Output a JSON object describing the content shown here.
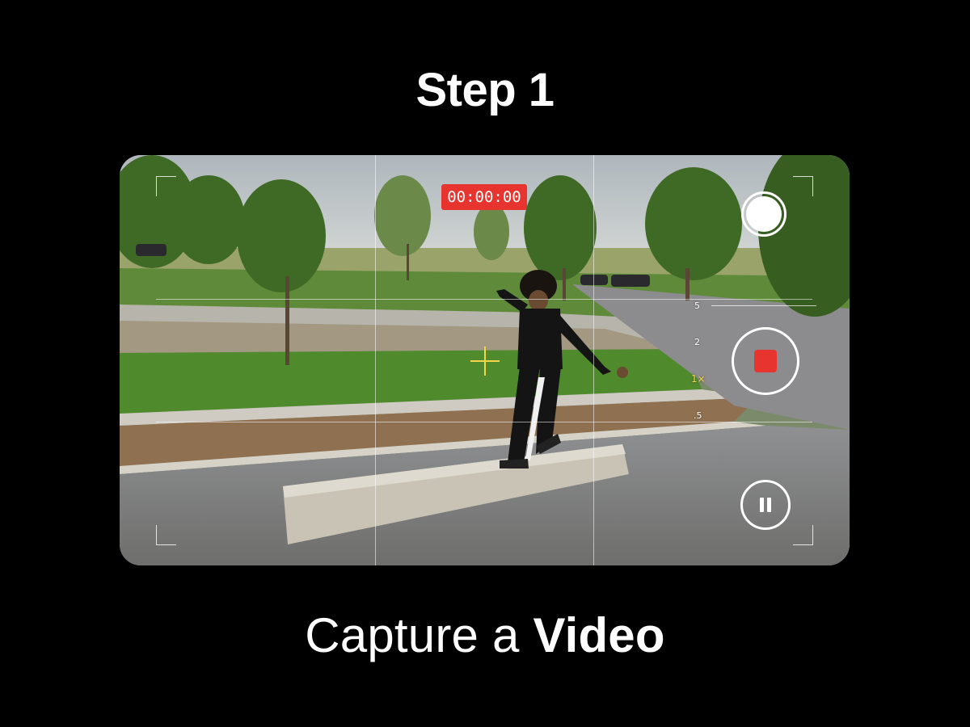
{
  "header": {
    "step_title": "Step 1"
  },
  "caption": {
    "text_regular": "Capture a ",
    "text_bold": "Video"
  },
  "camera": {
    "timer": "00:00:00",
    "zoom_levels": [
      {
        "label": "5",
        "active": false
      },
      {
        "label": "2",
        "active": false
      },
      {
        "label": "1×",
        "active": true
      },
      {
        "label": ".5",
        "active": false
      }
    ],
    "colors": {
      "record_red": "#e8342f",
      "focus_yellow": "#f5d64a"
    },
    "icons": {
      "shutter": "shutter-icon",
      "record_stop": "stop-record-icon",
      "pause": "pause-icon",
      "focus": "focus-crosshair-icon"
    }
  }
}
